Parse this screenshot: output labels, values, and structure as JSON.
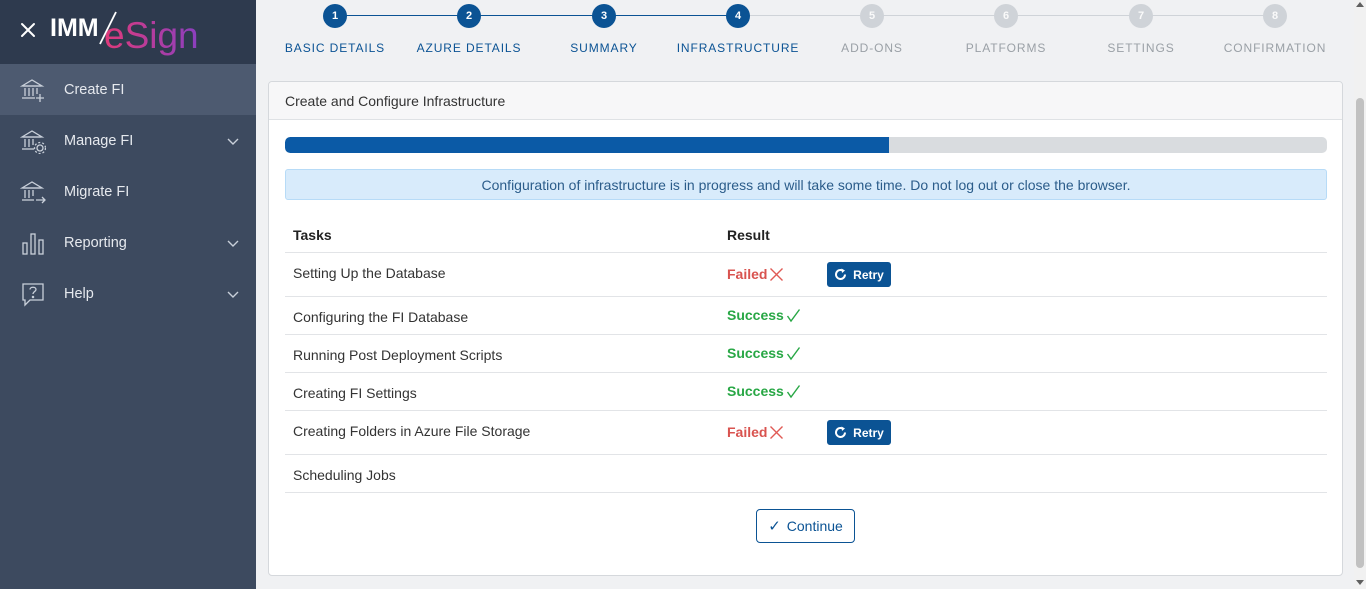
{
  "app": {
    "logo_imm": "IMM",
    "logo_esign": "eSign"
  },
  "sidebar": {
    "items": [
      {
        "label": "Create FI",
        "icon": "bank-plus-icon",
        "active": true,
        "expandable": false
      },
      {
        "label": "Manage FI",
        "icon": "bank-gear-icon",
        "active": false,
        "expandable": true
      },
      {
        "label": "Migrate FI",
        "icon": "bank-arrow-icon",
        "active": false,
        "expandable": false
      },
      {
        "label": "Reporting",
        "icon": "bar-chart-icon",
        "active": false,
        "expandable": true
      },
      {
        "label": "Help",
        "icon": "help-icon",
        "active": false,
        "expandable": true
      }
    ]
  },
  "stepper": {
    "steps": [
      {
        "number": "1",
        "label": "BASIC DETAILS",
        "state": "done"
      },
      {
        "number": "2",
        "label": "AZURE DETAILS",
        "state": "done"
      },
      {
        "number": "3",
        "label": "SUMMARY",
        "state": "done"
      },
      {
        "number": "4",
        "label": "INFRASTRUCTURE",
        "state": "current"
      },
      {
        "number": "5",
        "label": "ADD-ONS",
        "state": "todo"
      },
      {
        "number": "6",
        "label": "PLATFORMS",
        "state": "todo"
      },
      {
        "number": "7",
        "label": "SETTINGS",
        "state": "todo"
      },
      {
        "number": "8",
        "label": "CONFIRMATION",
        "state": "todo"
      }
    ]
  },
  "card": {
    "title": "Create and Configure Infrastructure",
    "progress_fraction": 0.58,
    "alert": "Configuration of infrastructure is in progress and will take some time. Do not log out or close the browser.",
    "table": {
      "headers": {
        "task": "Tasks",
        "result": "Result"
      },
      "rows": [
        {
          "task": "Setting Up the Database",
          "result": "Failed",
          "retry": "Retry"
        },
        {
          "task": "Configuring the FI Database",
          "result": "Success",
          "retry": ""
        },
        {
          "task": "Running Post Deployment Scripts",
          "result": "Success",
          "retry": ""
        },
        {
          "task": "Creating FI Settings",
          "result": "Success",
          "retry": ""
        },
        {
          "task": "Creating Folders in Azure File Storage",
          "result": "Failed",
          "retry": "Retry"
        },
        {
          "task": "Scheduling Jobs",
          "result": "",
          "retry": ""
        }
      ]
    },
    "continue_label": "Continue"
  },
  "colors": {
    "primary": "#0b5394",
    "success": "#28a745",
    "failed": "#d9534f",
    "sidebar_bg": "#3d4a5f",
    "sidebar_header_bg": "#2e3a4e",
    "logo_accent": "#c2348a"
  }
}
